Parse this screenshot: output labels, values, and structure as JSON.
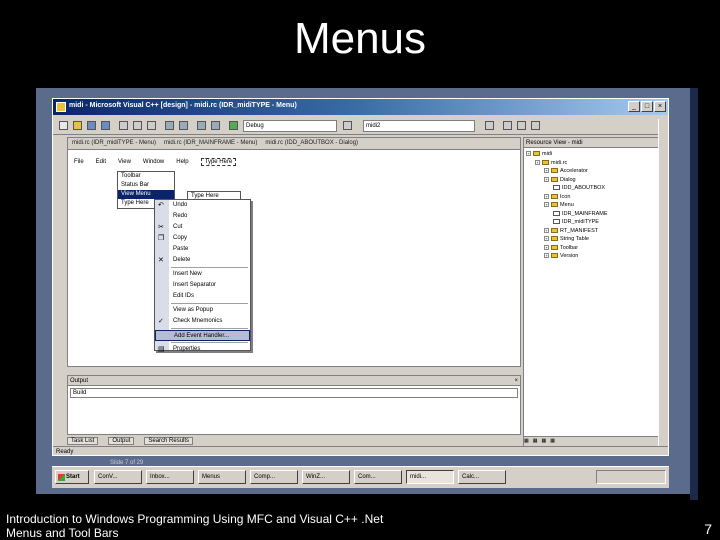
{
  "slide": {
    "title": "Menus",
    "footer_line1": "Introduction to Windows Programming Using MFC and Visual C++ .Net",
    "footer_line2": "Menus and Tool Bars",
    "page_number": "7"
  },
  "window": {
    "title": "midi - Microsoft Visual C++ [design] - midi.rc (IDR_midiTYPE - Menu)",
    "buttons": [
      "_",
      "□",
      "×"
    ]
  },
  "toolbar": {
    "config_combo": "Debug",
    "find_combo": "midi2"
  },
  "doc_tabs": [
    "midi.rc (IDR_midiTYPE - Menu)",
    "midi.rc (IDR_MAINFRAME - Menu)",
    "midi.rc (IDD_ABOUTBOX - Dialog)"
  ],
  "menu_bar": {
    "items": [
      "File",
      "Edit",
      "View",
      "Window",
      "Help"
    ],
    "type_here": "Type Here"
  },
  "view_menu": {
    "items": [
      "Toolbar",
      "Status Bar",
      "View Menu",
      "Type Here"
    ],
    "selected_index": 2
  },
  "submenu_type_here": "Type Here",
  "context_menu": {
    "items": [
      {
        "label": "Undo",
        "icon": "undo-icon",
        "glyph": "↶"
      },
      {
        "label": "Redo",
        "icon": "redo-icon",
        "glyph": ""
      },
      {
        "label": "Cut",
        "icon": "cut-icon",
        "glyph": "✂"
      },
      {
        "label": "Copy",
        "icon": "copy-icon",
        "glyph": "❐"
      },
      {
        "label": "Paste",
        "icon": "paste-icon",
        "glyph": ""
      },
      {
        "label": "Delete",
        "icon": "delete-icon",
        "glyph": "✕"
      },
      {
        "label": "Insert New",
        "icon": "",
        "glyph": ""
      },
      {
        "label": "Insert Separator",
        "icon": "",
        "glyph": ""
      },
      {
        "label": "Edit IDs",
        "icon": "",
        "glyph": ""
      },
      {
        "label": "View as Popup",
        "icon": "",
        "glyph": ""
      },
      {
        "label": "Check Mnemonics",
        "icon": "check-icon",
        "glyph": "✓"
      },
      {
        "label": "Add Event Handler...",
        "icon": "",
        "glyph": ""
      },
      {
        "label": "Properties",
        "icon": "properties-icon",
        "glyph": "▤"
      }
    ],
    "separators_after": [
      5,
      8,
      10,
      11
    ],
    "highlighted_index": 11
  },
  "output": {
    "title": "Output",
    "combo": "Build"
  },
  "bottom_tabs": [
    "Task List",
    "Output",
    "Search Results"
  ],
  "resource_view": {
    "title": "Resource View - midi",
    "tree": [
      {
        "label": "midi",
        "level": 0
      },
      {
        "label": "midi.rc",
        "level": 1
      },
      {
        "label": "Accelerator",
        "level": 2
      },
      {
        "label": "Dialog",
        "level": 2
      },
      {
        "label": "IDD_ABOUTBOX",
        "level": 3
      },
      {
        "label": "Icon",
        "level": 2
      },
      {
        "label": "Menu",
        "level": 2
      },
      {
        "label": "IDR_MAINFRAME",
        "level": 3
      },
      {
        "label": "IDR_midiTYPE",
        "level": 3
      },
      {
        "label": "RT_MANIFEST",
        "level": 2
      },
      {
        "label": "String Table",
        "level": 2
      },
      {
        "label": "Toolbar",
        "level": 2
      },
      {
        "label": "Version",
        "level": 2
      }
    ]
  },
  "status_bar": {
    "text": "Ready"
  },
  "behind_window_text": "Slide 7 of 29",
  "taskbar": {
    "start_label": "Start",
    "buttons": [
      "ConV...",
      "Inbox...",
      "Menus",
      "Comp...",
      "WinZ...",
      "Com...",
      "midi...",
      "Calc..."
    ],
    "active_index": 6
  }
}
